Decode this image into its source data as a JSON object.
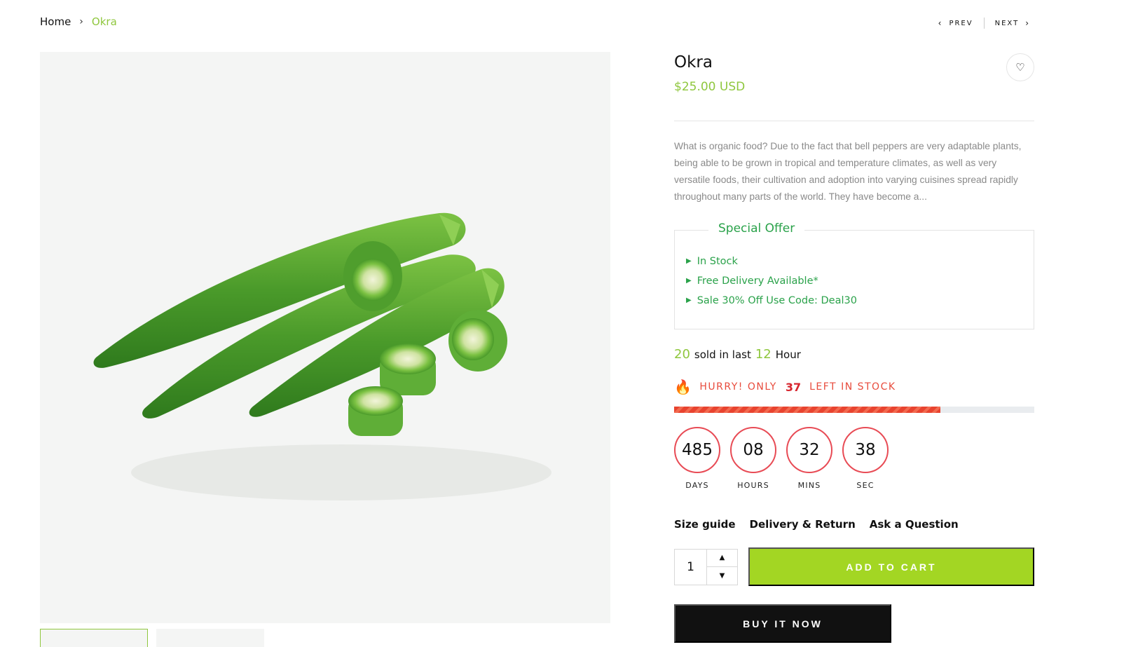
{
  "breadcrumb": {
    "home": "Home",
    "separator": "›",
    "current": "Okra"
  },
  "pager": {
    "prev": "PREV",
    "next": "NEXT"
  },
  "product": {
    "title": "Okra",
    "price": "$25.00 USD",
    "description": "What is organic food? Due to the fact that bell peppers are very adaptable plants, being able to be grown in tropical and temperature climates, as well as very versatile foods, their cultivation and adoption into varying cuisines spread rapidly throughout many parts of the world. They have become a..."
  },
  "offer": {
    "title": "Special Offer",
    "items": [
      "In Stock",
      "Free Delivery Available*",
      "Sale 30% Off Use Code: Deal30"
    ]
  },
  "sold": {
    "count": "20",
    "text1": "sold in last",
    "hours": "12",
    "text2": "Hour"
  },
  "hurry": {
    "prefix": "HURRY! ONLY",
    "count": "37",
    "suffix": "LEFT IN STOCK",
    "stock_fraction": 0.74
  },
  "countdown": [
    {
      "value": "485",
      "label": "DAYS"
    },
    {
      "value": "08",
      "label": "HOURS"
    },
    {
      "value": "32",
      "label": "MINS"
    },
    {
      "value": "38",
      "label": "SEC"
    }
  ],
  "links": {
    "size_guide": "Size guide",
    "delivery": "Delivery & Return",
    "ask": "Ask a Question"
  },
  "cart": {
    "quantity": "1",
    "add_label": "ADD TO CART",
    "buy_label": "BUY IT NOW"
  },
  "colors": {
    "accent": "#8fc73e",
    "button_green": "#a3d623",
    "offer_green": "#2aa24a",
    "alert_red": "#e84b3c"
  },
  "icons": {
    "heart": "heart-icon",
    "fire": "fire-icon",
    "chevron": "chevron-icon"
  }
}
